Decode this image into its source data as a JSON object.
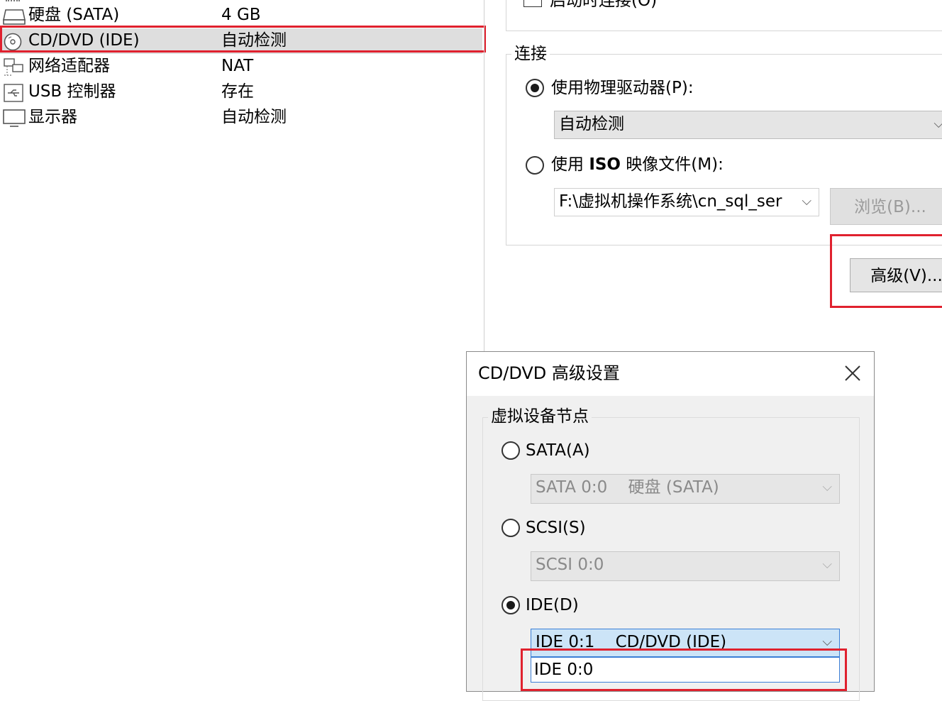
{
  "device_list": [
    {
      "name": "硬盘 (SATA)",
      "value": "4 GB",
      "icon": "hard-disk-icon"
    },
    {
      "name": "CD/DVD (IDE)",
      "value": "自动检测",
      "icon": "cd-dvd-icon"
    },
    {
      "name": "网络适配器",
      "value": "NAT",
      "icon": "network-adapter-icon"
    },
    {
      "name": "USB 控制器",
      "value": "存在",
      "icon": "usb-icon"
    },
    {
      "name": "显示器",
      "value": "自动检测",
      "icon": "monitor-icon"
    }
  ],
  "device_panel": {
    "connect_on_start_label": "启动时连接(O)",
    "connection_group_label": "连接",
    "use_physical_drive_label": "使用物理驱动器(P):",
    "physical_drive_value": "自动检测",
    "use_iso_label_prefix": "使用 ",
    "use_iso_label_bold": "ISO",
    "use_iso_label_suffix": " 映像文件(M):",
    "iso_path_value": "F:\\虚拟机操作系统\\cn_sql_ser",
    "browse_button": "浏览(B)...",
    "advanced_button": "高级(V)..."
  },
  "advanced_dialog": {
    "title": "CD/DVD 高级设置",
    "group_label": "虚拟设备节点",
    "sata_label": "SATA(A)",
    "sata_value": "SATA 0:0    硬盘 (SATA)",
    "scsi_label": "SCSI(S)",
    "scsi_value": "SCSI 0:0",
    "ide_label": "IDE(D)",
    "ide_value": "IDE 0:1    CD/DVD (IDE)",
    "ide_dropdown_option": "IDE 0:0"
  },
  "colors": {
    "highlight_red": "#e0212e",
    "selection_blue": "#cce4f7"
  }
}
